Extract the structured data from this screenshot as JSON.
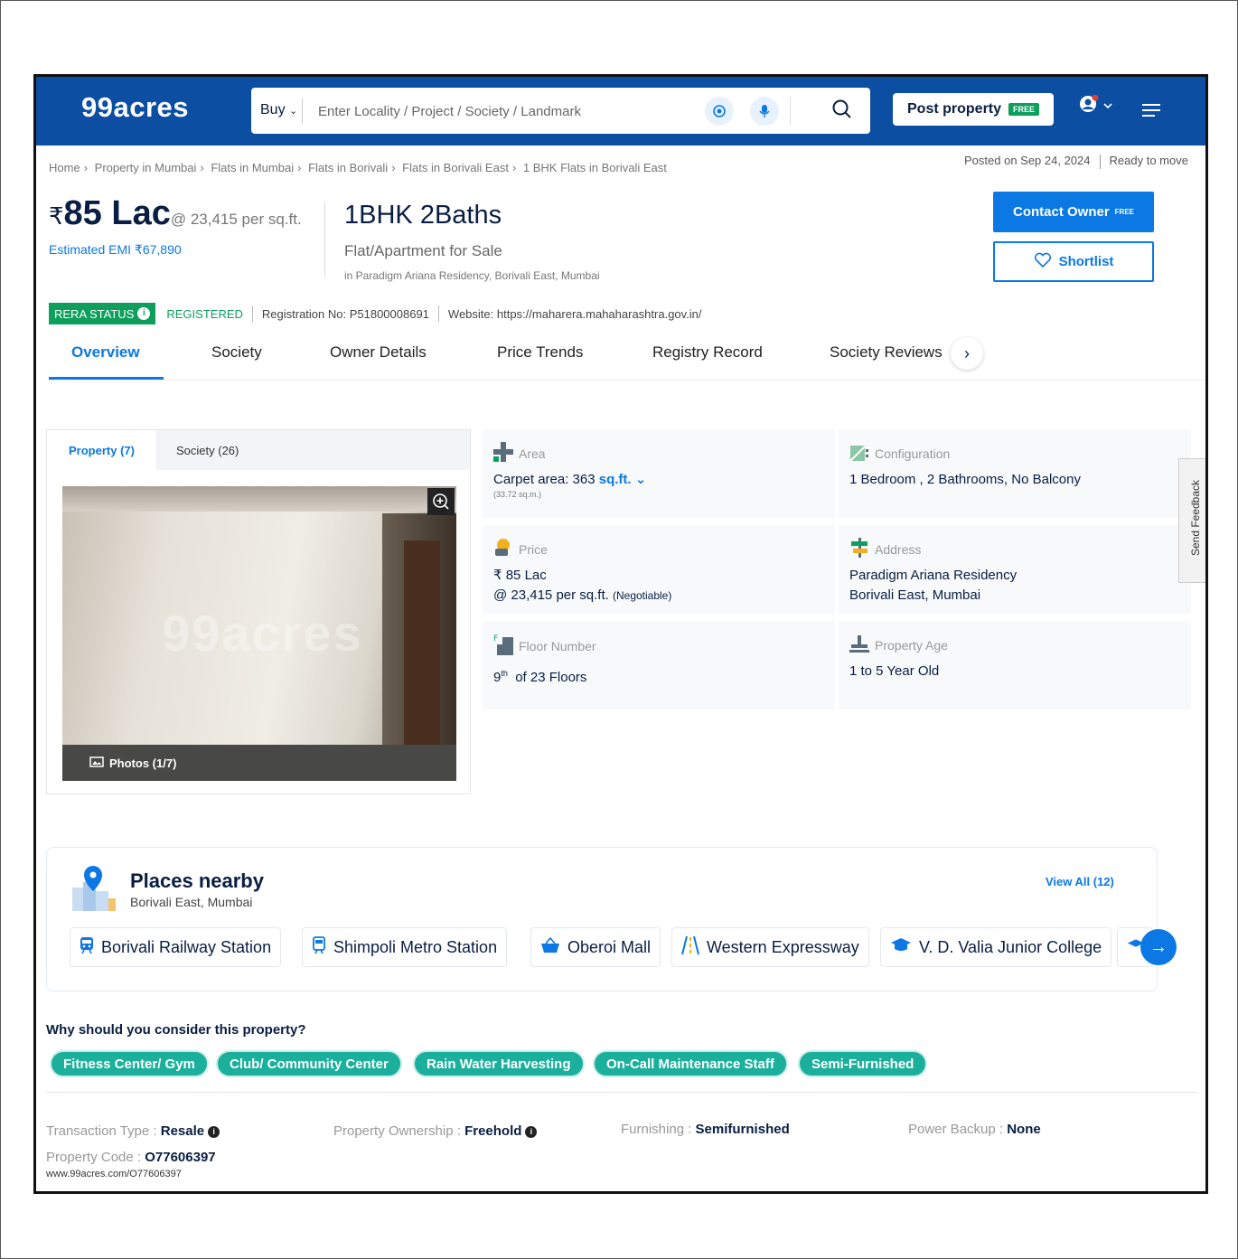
{
  "header": {
    "logo": "99acres",
    "buy_label": "Buy",
    "search_placeholder": "Enter Locality / Project / Society / Landmark",
    "post_property": "Post property",
    "free_tag": "FREE"
  },
  "breadcrumb": [
    "Home",
    "Property in Mumbai",
    "Flats in Mumbai",
    "Flats in Borivali",
    "Flats in Borivali East",
    "1 BHK Flats in Borivali East"
  ],
  "posted": {
    "date": "Posted on Sep 24, 2024",
    "status": "Ready to move"
  },
  "listing": {
    "rupee": "₹",
    "price": "85 Lac",
    "price_per_sqft": "@ 23,415 per sq.ft.",
    "emi": "Estimated EMI ₹67,890",
    "title": "1BHK 2Baths",
    "subtitle": "Flat/Apartment for Sale",
    "location": "in Paradigm Ariana Residency, Borivali East, Mumbai"
  },
  "actions": {
    "contact": "Contact Owner",
    "contact_tag": "FREE",
    "shortlist": "Shortlist"
  },
  "rera": {
    "label": "RERA STATUS",
    "status": "REGISTERED",
    "reg_no": "Registration No: P51800008691",
    "website": "Website: https://maharera.mahaharashtra.gov.in/"
  },
  "tabs": [
    "Overview",
    "Society",
    "Owner Details",
    "Price Trends",
    "Registry Record",
    "Society Reviews"
  ],
  "gallery": {
    "tab_property": "Property (7)",
    "tab_society": "Society (26)",
    "watermark": "99acres",
    "photos": "Photos (1/7)"
  },
  "details": {
    "area": {
      "label": "Area",
      "value": "Carpet area: 363",
      "unit": "sq.ft.",
      "sub": "(33.72 sq.m.)"
    },
    "configuration": {
      "label": "Configuration",
      "value": "1 Bedroom , 2 Bathrooms, No Balcony"
    },
    "price": {
      "label": "Price",
      "line1": "₹ 85 Lac",
      "line2": "@ 23,415 per sq.ft.",
      "negotiable": "(Negotiable)"
    },
    "address": {
      "label": "Address",
      "line1": "Paradigm Ariana Residency",
      "line2": "Borivali East, Mumbai"
    },
    "floor": {
      "label": "Floor Number",
      "floor": "9",
      "suffix": "th",
      "of": "of 23 Floors"
    },
    "age": {
      "label": "Property Age",
      "value": "1 to 5 Year Old"
    }
  },
  "feedback": "Send Feedback",
  "nearby": {
    "title": "Places nearby",
    "subtitle": "Borivali East, Mumbai",
    "view_all": "View All (12)",
    "places": [
      "Borivali Railway Station",
      "Shimpoli Metro Station",
      "Oberoi Mall",
      "Western Expressway",
      "V. D. Valia Junior College"
    ]
  },
  "why": {
    "title": "Why should you consider this property?",
    "features": [
      "Fitness Center/ Gym",
      "Club/ Community Center",
      "Rain Water Harvesting",
      "On-Call Maintenance Staff",
      "Semi-Furnished"
    ]
  },
  "meta": {
    "transaction_label": "Transaction Type : ",
    "transaction_value": "Resale",
    "ownership_label": "Property Ownership : ",
    "ownership_value": "Freehold",
    "furnishing_label": "Furnishing : ",
    "furnishing_value": "Semifurnished",
    "power_label": "Power Backup : ",
    "power_value": "None",
    "code_label": "Property Code : ",
    "code_value": "O77606397",
    "url": "www.99acres.com/O77606397"
  },
  "colors": {
    "brand": "#0B4EA2",
    "accent": "#0B78E3",
    "green": "#0E9F5C",
    "teal": "#1BAF9C"
  }
}
